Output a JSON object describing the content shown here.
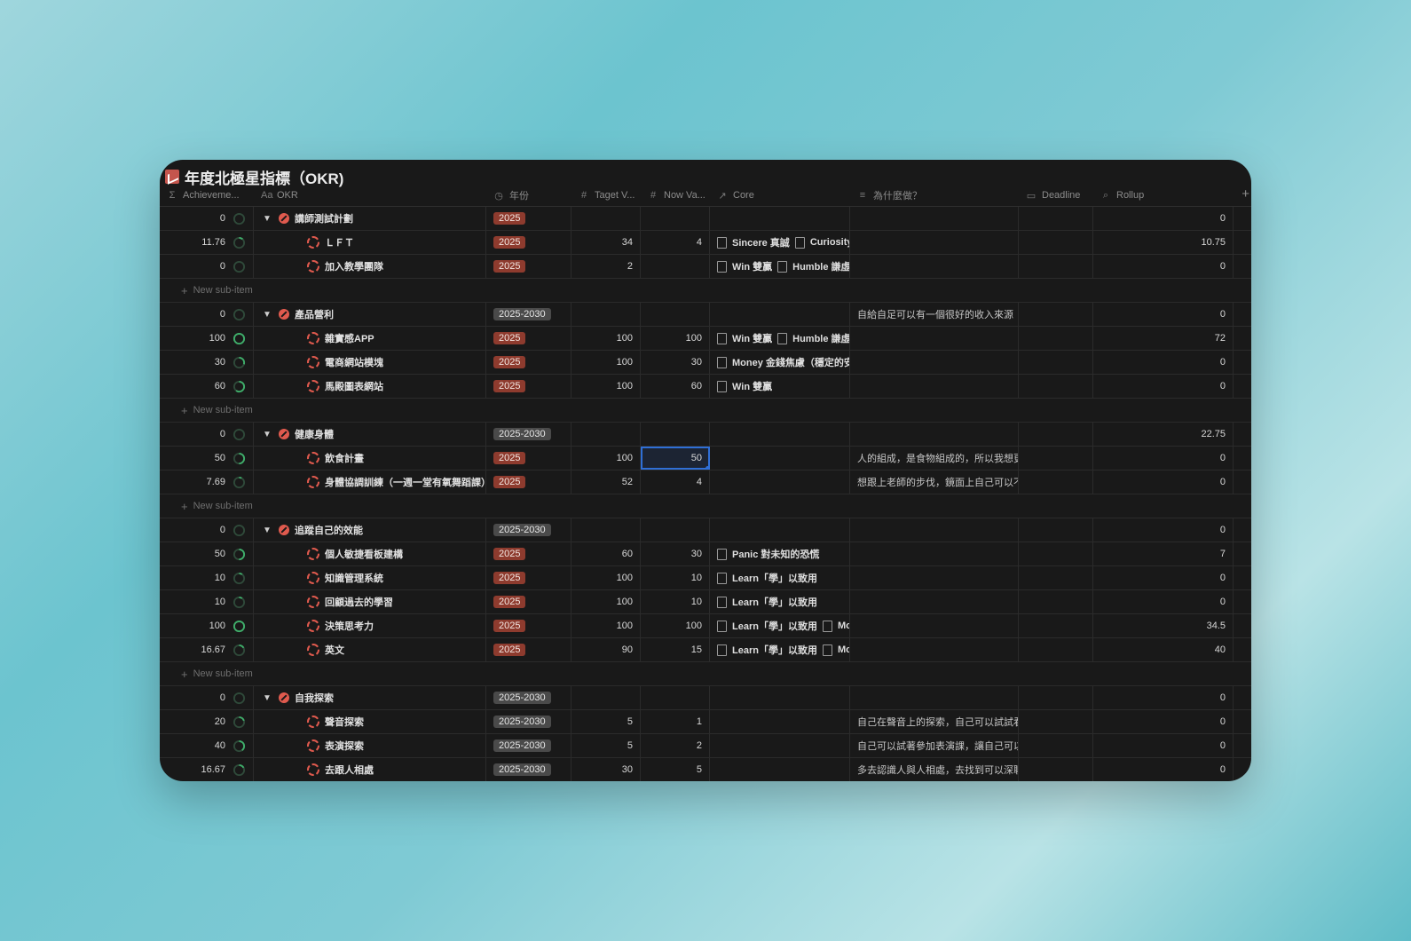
{
  "title": "年度北極星指標（OKR)",
  "columns": {
    "achievement": "Achieveme...",
    "okr": "OKR",
    "year": "年份",
    "target": "Taget V...",
    "now": "Now Va...",
    "core": "Core",
    "why": "為什麼做？",
    "deadline": "Deadline",
    "rollup": "Rollup"
  },
  "column_icons": {
    "achievement": "Σ",
    "okr": "Aa",
    "year": "◷",
    "target": "#",
    "now": "#",
    "core": "↗",
    "why": "≡",
    "deadline": "▭",
    "rollup": "⌕"
  },
  "new_sub_item_label": "New sub-item",
  "groups": [
    {
      "parent": {
        "ach": "0",
        "progress": 0,
        "okr": "講師測試計劃",
        "year": "2025",
        "year_style": "red",
        "target": "",
        "now": "",
        "core": [],
        "why": "",
        "rollup": "0"
      },
      "children": [
        {
          "ach": "11.76",
          "progress": 0.12,
          "okr": "ＬＦＴ",
          "year": "2025",
          "year_style": "red",
          "target": "34",
          "now": "4",
          "core": [
            "Sincere 真誠",
            "Curiosity"
          ],
          "why": "",
          "rollup": "10.75"
        },
        {
          "ach": "0",
          "progress": 0,
          "okr": "加入教學團隊",
          "year": "2025",
          "year_style": "red",
          "target": "2",
          "now": "",
          "core": [
            "Win 雙贏",
            "Humble 謙虛"
          ],
          "why": "",
          "rollup": "0"
        }
      ]
    },
    {
      "parent": {
        "ach": "0",
        "progress": 0,
        "okr": "產品營利",
        "year": "2025-2030",
        "year_style": "gray",
        "target": "",
        "now": "",
        "core": [],
        "why": "自給自足可以有一個很好的收入來源",
        "rollup": "0"
      },
      "children": [
        {
          "ach": "100",
          "progress": 1,
          "okr": "雜實感APP",
          "year": "2025",
          "year_style": "red",
          "target": "100",
          "now": "100",
          "core": [
            "Win 雙贏",
            "Humble 謙虛"
          ],
          "why": "",
          "rollup": "72"
        },
        {
          "ach": "30",
          "progress": 0.3,
          "okr": "電商網站模塊",
          "year": "2025",
          "year_style": "red",
          "target": "100",
          "now": "30",
          "core": [
            "Money 金錢焦慮（穩定的安"
          ],
          "why": "",
          "rollup": "0"
        },
        {
          "ach": "60",
          "progress": 0.6,
          "okr": "馬殿圖表網站",
          "year": "2025",
          "year_style": "red",
          "target": "100",
          "now": "60",
          "core": [
            "Win 雙贏"
          ],
          "why": "",
          "rollup": "0"
        }
      ]
    },
    {
      "parent": {
        "ach": "0",
        "progress": 0,
        "okr": "健康身體",
        "year": "2025-2030",
        "year_style": "gray",
        "target": "",
        "now": "",
        "core": [],
        "why": "",
        "rollup": "22.75"
      },
      "children": [
        {
          "ach": "50",
          "progress": 0.5,
          "okr": "飲食計畫",
          "year": "2025",
          "year_style": "red",
          "target": "100",
          "now": "50",
          "selected": true,
          "core": [],
          "why": "人的組成，是食物組成的，所以我想更好",
          "rollup": "0"
        },
        {
          "ach": "7.69",
          "progress": 0.08,
          "okr": "身體協調訓練（一週一堂有氧舞蹈課）",
          "year": "2025",
          "year_style": "red",
          "target": "52",
          "now": "4",
          "core": [],
          "why": "想跟上老師的步伐，鏡面上自己可以不那麼",
          "rollup": "0"
        }
      ]
    },
    {
      "parent": {
        "ach": "0",
        "progress": 0,
        "okr": "追蹤自己的效能",
        "year": "2025-2030",
        "year_style": "gray",
        "target": "",
        "now": "",
        "core": [],
        "why": "",
        "rollup": "0"
      },
      "children": [
        {
          "ach": "50",
          "progress": 0.5,
          "okr": "個人敏捷看板建構",
          "year": "2025",
          "year_style": "red",
          "target": "60",
          "now": "30",
          "core": [
            "Panic 對未知的恐慌"
          ],
          "why": "",
          "rollup": "7"
        },
        {
          "ach": "10",
          "progress": 0.1,
          "okr": "知識管理系統",
          "year": "2025",
          "year_style": "red",
          "target": "100",
          "now": "10",
          "core": [
            "Learn「學」以致用"
          ],
          "why": "",
          "rollup": "0"
        },
        {
          "ach": "10",
          "progress": 0.1,
          "okr": "回顧過去的學習",
          "year": "2025",
          "year_style": "red",
          "target": "100",
          "now": "10",
          "core": [
            "Learn「學」以致用"
          ],
          "why": "",
          "rollup": "0"
        },
        {
          "ach": "100",
          "progress": 1,
          "okr": "決策思考力",
          "year": "2025",
          "year_style": "red",
          "target": "100",
          "now": "100",
          "core": [
            "Learn「學」以致用",
            "Mo"
          ],
          "why": "",
          "rollup": "34.5"
        },
        {
          "ach": "16.67",
          "progress": 0.17,
          "okr": "英文",
          "year": "2025",
          "year_style": "red",
          "target": "90",
          "now": "15",
          "core": [
            "Learn「學」以致用",
            "Mo"
          ],
          "why": "",
          "rollup": "40"
        }
      ]
    },
    {
      "parent": {
        "ach": "0",
        "progress": 0,
        "okr": "自我探索",
        "year": "2025-2030",
        "year_style": "gray",
        "target": "",
        "now": "",
        "core": [],
        "why": "",
        "rollup": "0"
      },
      "children": [
        {
          "ach": "20",
          "progress": 0.2,
          "okr": "聲音探索",
          "year": "2025-2030",
          "year_style": "gray",
          "target": "5",
          "now": "1",
          "core": [],
          "why": "自己在聲音上的探索，自己可以試試看",
          "rollup": "0"
        },
        {
          "ach": "40",
          "progress": 0.4,
          "okr": "表演探索",
          "year": "2025-2030",
          "year_style": "gray",
          "target": "5",
          "now": "2",
          "core": [],
          "why": "自己可以試著參加表演課，讓自己可以更",
          "rollup": "0"
        },
        {
          "ach": "16.67",
          "progress": 0.17,
          "okr": "去跟人相處",
          "year": "2025-2030",
          "year_style": "gray",
          "target": "30",
          "now": "5",
          "core": [],
          "why": "多去認識人與人相處，去找到可以深聊的人",
          "rollup": "0"
        }
      ]
    }
  ],
  "colors": {
    "ring_track": "#2f4a3a",
    "ring_fill": "#3fae6a",
    "accent_red": "#e05a4e",
    "select_blue": "#2f6fd6"
  }
}
